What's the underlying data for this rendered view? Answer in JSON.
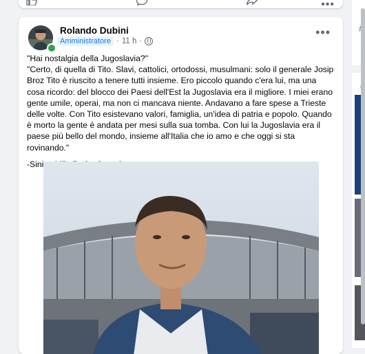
{
  "previous_post": {
    "more_label": "•••"
  },
  "post": {
    "author": "Rolando Dubini",
    "role_badge": "Amministratore",
    "meta_separator": "·",
    "time": "11 h",
    "meta_separator_2": "·",
    "more_label": "•••",
    "body_lines": [
      "\"Hai nostalgia della Jugoslavia?\"",
      "\"Certo, di quella di Tito. Slavi, cattolici, ortodossi, musulmani: solo il generale Josip Broz Tito è riuscito a tenere tutti insieme. Ero piccolo quando c'era lui, ma una cosa ricordo: del blocco dei Paesi dell'Est la Jugoslavia era il migliore. I miei erano gente umile, operai, ma non ci mancava niente. Andavano a fare spese a Trieste delle volte. Con Tito esistevano valori, famiglia, un'idea di patria e popolo. Quando è morto la gente è andata per mesi sulla sua tomba. Con lui la Jugoslavia era il paese più bello del mondo, insieme all'Italia che io amo e che oggi si sta rovinando.\""
    ],
    "signature": "-Sinisa Mihajlovic- Jugoslavo"
  },
  "right_panel": {
    "line1": "#",
    "line2": "P",
    "line3": "C"
  },
  "colors": {
    "background": "#f0f2f5",
    "card": "#ffffff",
    "link_blue": "#1877f2",
    "secondary_text": "#65676b",
    "online_green": "#31a24c"
  }
}
